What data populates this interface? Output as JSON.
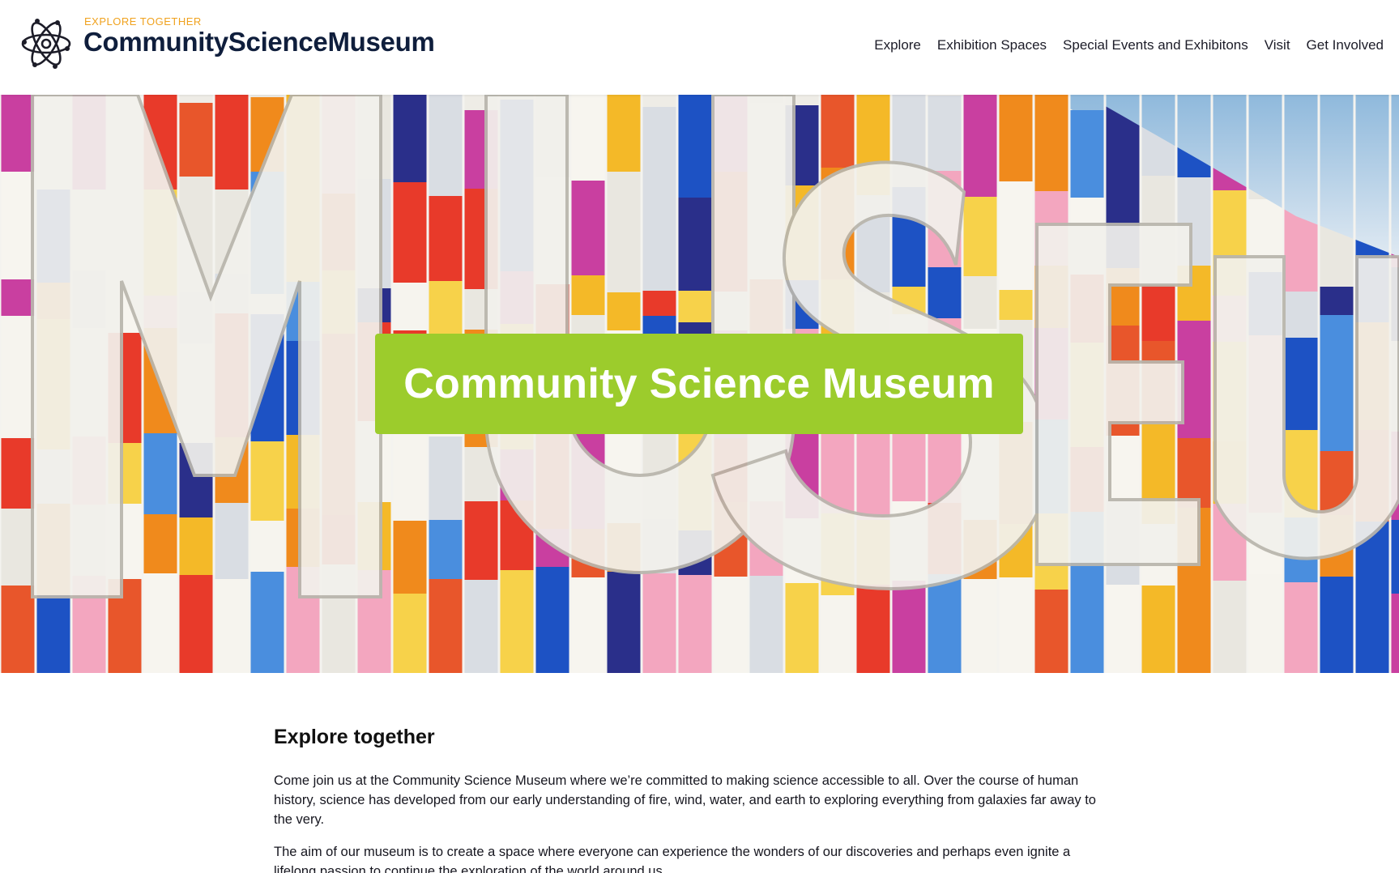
{
  "header": {
    "tagline": "EXPLORE TOGETHER",
    "site_name": "CommunityScienceMuseum",
    "logo_icon": "atom-icon",
    "nav": [
      {
        "label": "Explore"
      },
      {
        "label": "Exhibition Spaces"
      },
      {
        "label": "Special Events and Exhibitons"
      },
      {
        "label": "Visit"
      },
      {
        "label": "Get Involved"
      }
    ]
  },
  "hero": {
    "title": "Community Science Museum",
    "title_bg_color": "#9ccc2c",
    "image_subject": "MUSEUM"
  },
  "main": {
    "heading": "Explore together",
    "paragraphs": [
      "Come join us at the Community Science Museum where we’re committed to making science accessible to all. Over the course of human history, science has developed from our early understanding of fire, wind, water, and earth to exploring everything from galaxies far away to the very.",
      "The aim of our museum is to create a space where everyone can experience the wonders of our discoveries and perhaps even ignite a lifelong passion to continue the exploration of the world around us."
    ]
  },
  "colors": {
    "accent": "#f0a21e",
    "brand_dark": "#0f1e3c"
  }
}
